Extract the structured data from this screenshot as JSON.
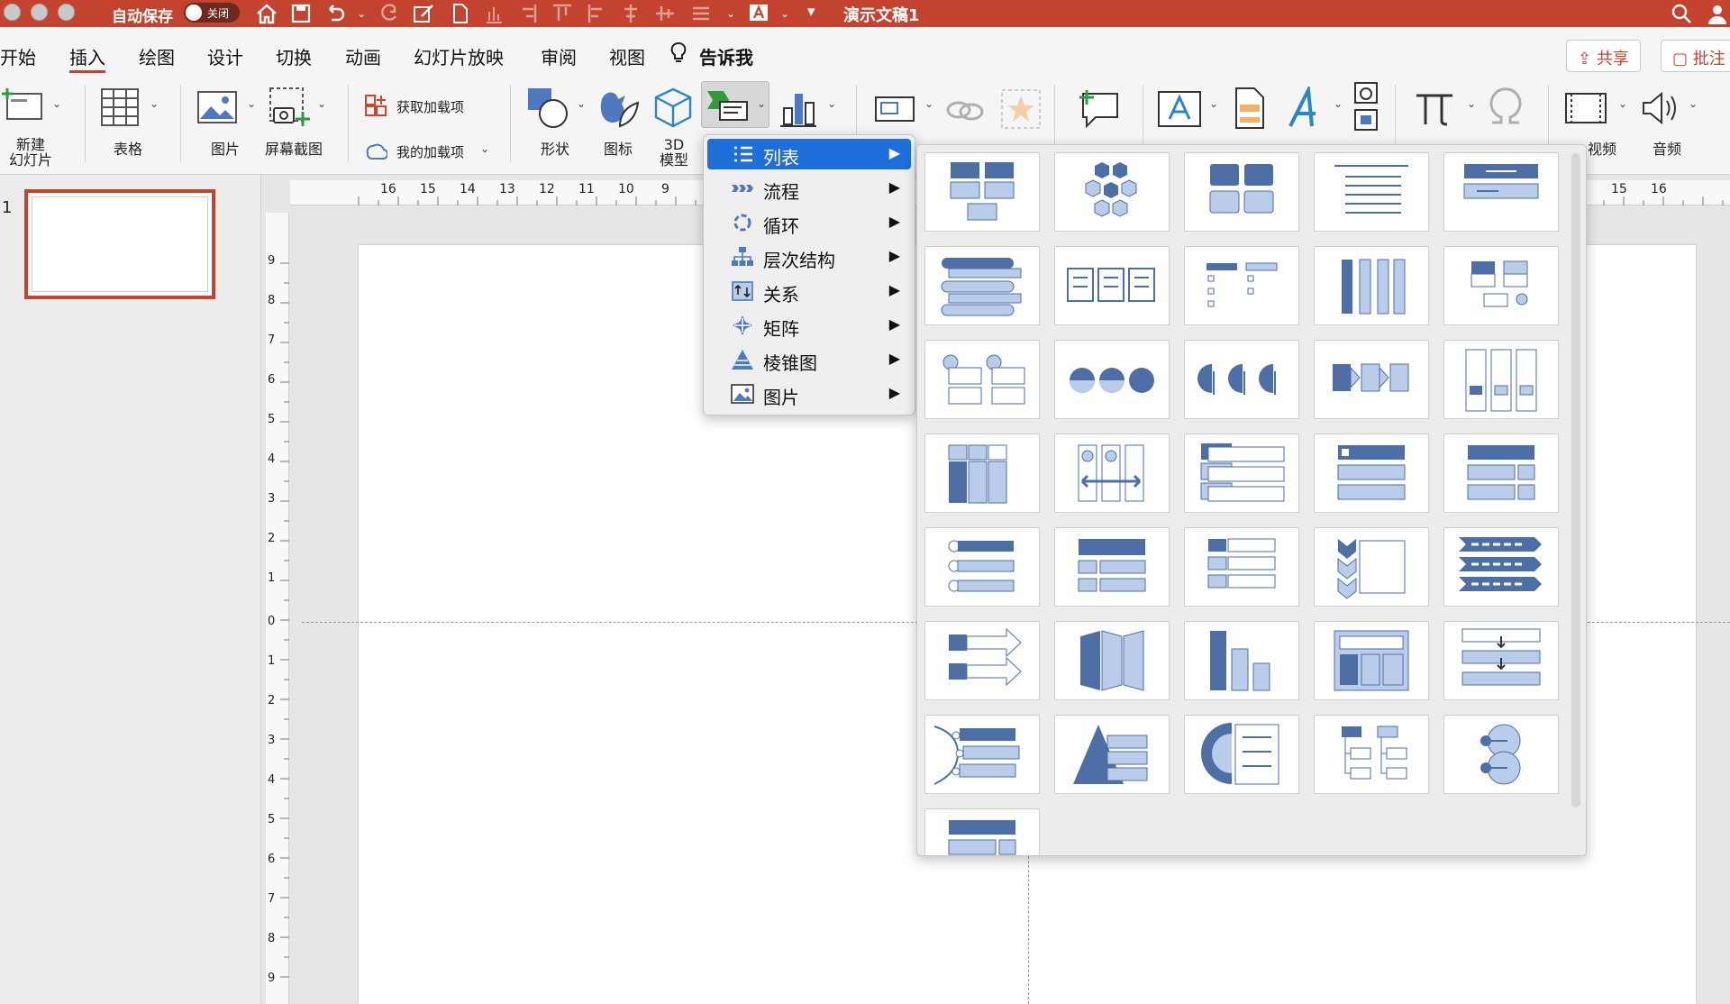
{
  "titlebar": {
    "autosave_label": "自动保存",
    "autosave_state": "关闭",
    "doc_title": "演示文稿1",
    "bg_color": "#c4432e"
  },
  "tabs": [
    {
      "label": "开始"
    },
    {
      "label": "插入",
      "active": true
    },
    {
      "label": "绘图"
    },
    {
      "label": "设计"
    },
    {
      "label": "切换"
    },
    {
      "label": "动画"
    },
    {
      "label": "幻灯片放映"
    },
    {
      "label": "审阅"
    },
    {
      "label": "视图"
    }
  ],
  "tell_me": "告诉我",
  "share_label": "共享",
  "comment_label": "批注",
  "ribbon": {
    "new_slide": "新建\n幻灯片",
    "table": "表格",
    "picture": "图片",
    "screenshot": "屏幕截图",
    "get_addins": "获取加载项",
    "my_addins": "我的加载项",
    "shapes": "形状",
    "icons": "图标",
    "model3d": "3D\n模型",
    "video": "视频",
    "audio": "音频"
  },
  "slides": [
    {
      "number": "1"
    }
  ],
  "ruler_h_labels": [
    "16",
    "15",
    "14",
    "13",
    "12",
    "11",
    "10",
    "9",
    "15",
    "16"
  ],
  "ruler_v_labels": [
    "9",
    "8",
    "7",
    "6",
    "5",
    "4",
    "3",
    "2",
    "1",
    "0",
    "1",
    "2",
    "3",
    "4",
    "5",
    "6",
    "7",
    "8",
    "9"
  ],
  "smartart_menu": [
    {
      "label": "列表",
      "icon": "list-icon",
      "selected": true
    },
    {
      "label": "流程",
      "icon": "process-icon"
    },
    {
      "label": "循环",
      "icon": "cycle-icon"
    },
    {
      "label": "层次结构",
      "icon": "hierarchy-icon"
    },
    {
      "label": "关系",
      "icon": "relationship-icon"
    },
    {
      "label": "矩阵",
      "icon": "matrix-icon"
    },
    {
      "label": "棱锥图",
      "icon": "pyramid-icon"
    },
    {
      "label": "图片",
      "icon": "picture-icon"
    }
  ],
  "gallery": {
    "tile_count": 36,
    "accent_dark": "#4e6ea6",
    "accent_light": "#b9cdea"
  }
}
